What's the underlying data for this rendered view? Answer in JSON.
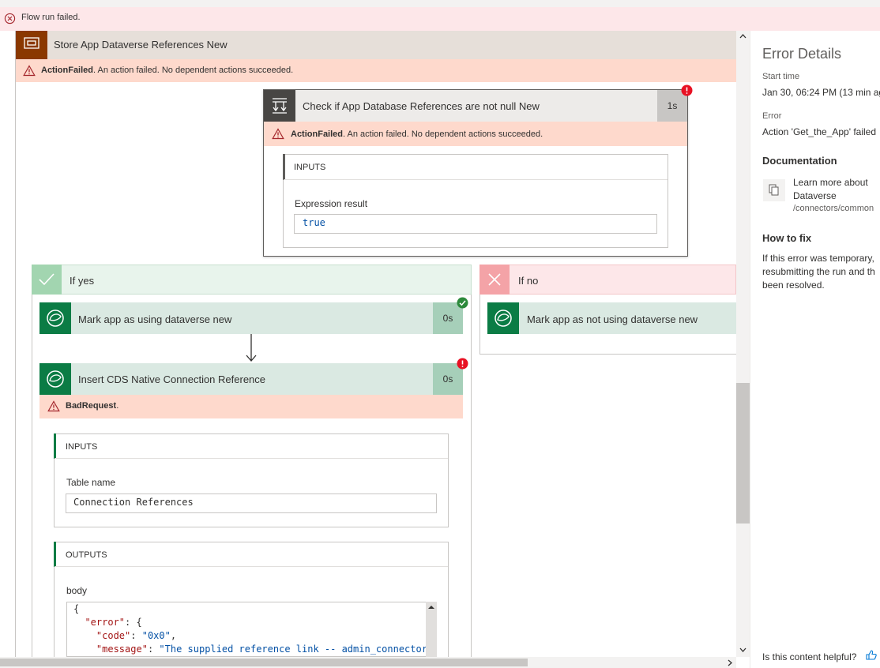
{
  "banner": {
    "text": "Flow run failed."
  },
  "scope": {
    "title": "Store App Dataverse References New",
    "error_code": "ActionFailed",
    "error_message": ". An action failed. No dependent actions succeeded."
  },
  "condition": {
    "title": "Check if App Database References are not null New",
    "duration": "1s",
    "error_code": "ActionFailed",
    "error_message": ". An action failed. No dependent actions succeeded.",
    "inputs_label": "INPUTS",
    "expression_label": "Expression result",
    "expression_value": "true"
  },
  "branch_yes": {
    "label": "If yes",
    "actions": [
      {
        "title": "Mark app as using dataverse new",
        "duration": "0s",
        "status": "success"
      },
      {
        "title": "Insert CDS Native Connection Reference",
        "duration": "0s",
        "status": "failed",
        "error_code": "BadRequest",
        "error_message": ".",
        "inputs_label": "INPUTS",
        "table_name_label": "Table name",
        "table_name_value": "Connection References",
        "outputs_label": "OUTPUTS",
        "body_label": "body",
        "body_lines": [
          {
            "p": "{",
            "k": "",
            "s": ""
          },
          {
            "p": "  ",
            "k": "\"error\"",
            "s": ": {"
          },
          {
            "p": "    ",
            "k": "\"code\"",
            "s": ": ",
            "v": "\"0x0\"",
            "t": ","
          },
          {
            "p": "    ",
            "k": "\"message\"",
            "s": ": ",
            "v": "\"The supplied reference link -- admin_connectors()"
          }
        ]
      }
    ]
  },
  "branch_no": {
    "label": "If no",
    "actions": [
      {
        "title": "Mark app as not using dataverse new"
      }
    ]
  },
  "side_panel": {
    "title": "Error Details",
    "start_time_label": "Start time",
    "start_time_value": "Jan 30, 06:24 PM (13 min ag",
    "error_label": "Error",
    "error_value": "Action 'Get_the_App' failed",
    "documentation_heading": "Documentation",
    "doc_link_line1": "Learn more about",
    "doc_link_line2": "Dataverse",
    "doc_link_path": "/connectors/common",
    "how_to_fix_heading": "How to fix",
    "fix_lines": [
      "If this error was temporary,",
      "resubmitting the run and th",
      "been resolved."
    ],
    "helpful_text": "Is this content helpful?"
  },
  "colors": {
    "error_banner": "#fde7e9",
    "warning_strip": "#fed9cc",
    "scope_brown": "#8a3800",
    "dataverse_green": "#0b7c45",
    "error_red": "#e81123",
    "success_green": "#2c8a3c"
  }
}
